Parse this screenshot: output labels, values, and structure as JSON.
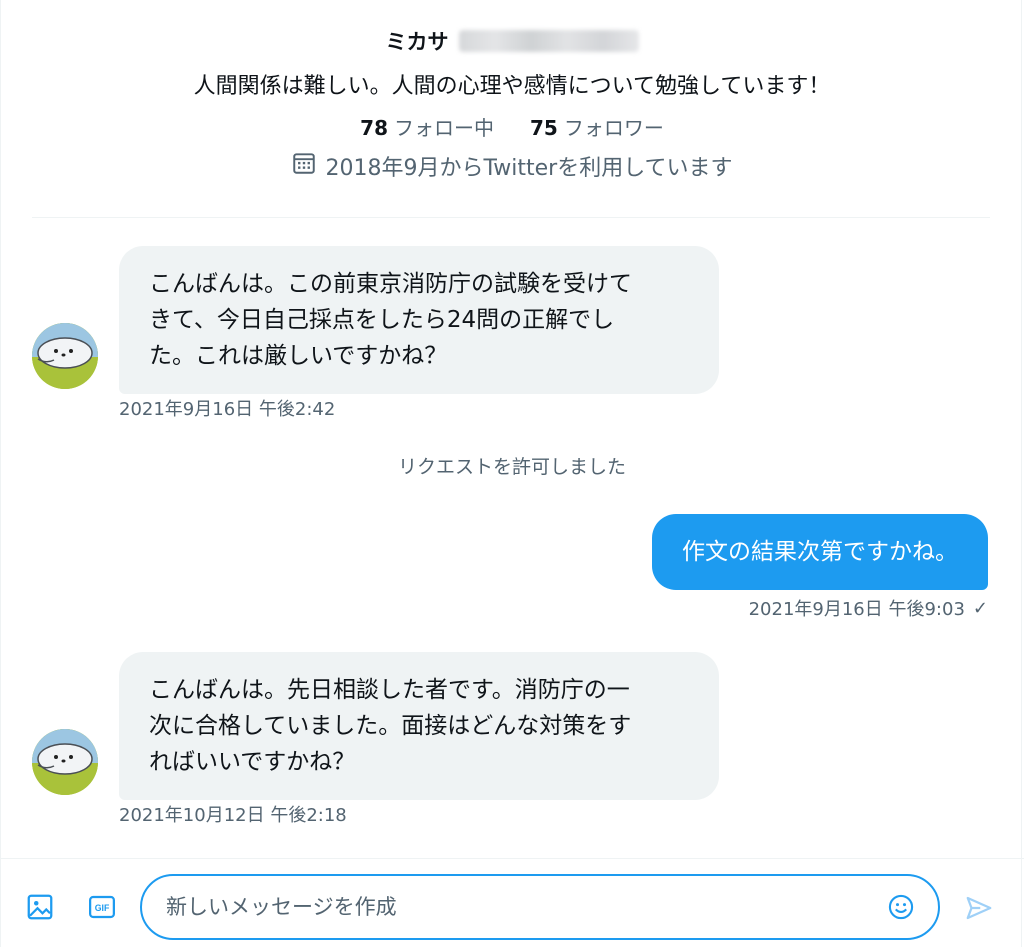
{
  "profile": {
    "name": "ミカサ",
    "bio": "人間関係は難しい。人間の心理や感情について勉強しています！",
    "following_count": "78",
    "following_label": "フォロー中",
    "followers_count": "75",
    "followers_label": "フォロワー",
    "joined": "2018年9月からTwitterを利用しています"
  },
  "messages": [
    {
      "direction": "incoming",
      "lines": [
        "こんばんは。この前東京消防庁の試験を受けて",
        "きて、今日自己採点をしたら24問の正解でし",
        "た。これは厳しいですかね？"
      ],
      "timestamp": "2021年9月16日 午後2:42"
    },
    {
      "direction": "outgoing",
      "text": "作文の結果次第ですかね。",
      "timestamp": "2021年9月16日 午後9:03",
      "read_mark": "✓"
    },
    {
      "direction": "incoming",
      "lines": [
        "こんばんは。先日相談した者です。消防庁の一",
        "次に合格していました。面接はどんな対策をす",
        "ればいいですかね？"
      ],
      "timestamp": "2021年10月12日 午後2:18"
    }
  ],
  "system_note": "リクエストを許可しました",
  "composer": {
    "placeholder": "新しいメッセージを作成",
    "gif_label": "GIF"
  },
  "icons": {
    "calendar": "calendar-icon",
    "media": "image-icon",
    "gif": "gif-icon",
    "emoji": "emoji-icon",
    "send": "send-icon"
  },
  "colors": {
    "accent": "#1d9bf0",
    "incoming_bubble": "#eff3f4",
    "secondary_text": "#536471",
    "avatar_bg": "#a9c23a"
  }
}
